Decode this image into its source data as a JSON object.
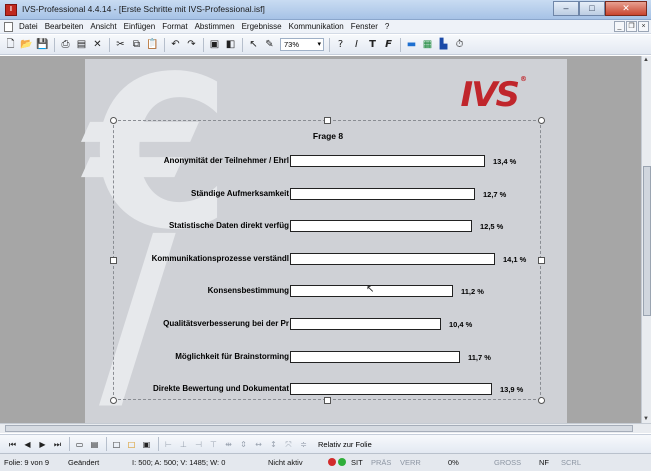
{
  "window": {
    "title": "IVS-Professional 4.4.14 - [Erste Schritte mit IVS-Professional.isf]",
    "app_icon": "ivs-app-icon",
    "controls": [
      "minimize",
      "maximize",
      "close"
    ]
  },
  "menubar": {
    "items": [
      "Datei",
      "Bearbeiten",
      "Ansicht",
      "Einfügen",
      "Format",
      "Abstimmen",
      "Ergebnisse",
      "Kommunikation",
      "Fenster",
      "?"
    ]
  },
  "toolbar": {
    "zoom": "73%",
    "icons": [
      "new-icon",
      "open-icon",
      "save-icon",
      "print-icon",
      "properties-icon",
      "delete-icon",
      "cut-icon",
      "copy-icon",
      "paste-icon",
      "undo-icon",
      "redo-icon",
      "insert-slide-icon",
      "duplicate-slide-icon",
      "pointer-icon",
      "pen-icon",
      "zoom-dropdown",
      "question-icon",
      "italic-icon",
      "bold-t-icon",
      "font-f-icon",
      "chart-gradient-icon",
      "chart-3d-icon",
      "bar-chart-icon",
      "timer-icon"
    ],
    "text_buttons": {
      "q": "?",
      "i": "I",
      "t": "T",
      "f": "F"
    }
  },
  "slide": {
    "logo_text": "IVS",
    "logo_mark": "®",
    "accent_color": "#c0262c"
  },
  "chart_data": {
    "type": "bar",
    "orientation": "horizontal",
    "title": "Frage 8",
    "categories": [
      "Anonymität der Teilnehmer / Ehrl",
      "Ständige Aufmerksamkeit",
      "Statistische Daten direkt verfüg",
      "Kommunikationsprozesse verständl",
      "Konsensbestimmung",
      "Qualitätsverbesserung bei der Pr",
      "Möglichkeit für Brainstorming",
      "Direkte Bewertung und Dokumentat"
    ],
    "values": [
      13.4,
      12.7,
      12.5,
      14.1,
      11.2,
      10.4,
      11.7,
      13.9
    ],
    "value_labels": [
      "13,4 %",
      "12,7 %",
      "12,5 %",
      "14,1 %",
      "11,2 %",
      "10,4 %",
      "11,7 %",
      "13,9 %"
    ],
    "bar_color": "#ffffff",
    "bar_border": "#222222",
    "grid": false,
    "legend": "none"
  },
  "bottombar": {
    "relative_label": "Relativ zur Folie"
  },
  "status": {
    "folie": "Folie: 9 von 9",
    "changed": "Geändert",
    "counters": "I: 500;  A: 500;  V: 1485;  W: 0",
    "active": "Nicht aktiv",
    "sit": "SIT",
    "pras": "PRÄS",
    "verr": "VERR",
    "percent": "0%",
    "gross": "GROSS",
    "nf": "NF",
    "scrl": "SCRL",
    "led_colors": [
      "#d22b2b",
      "#2fae3a"
    ]
  }
}
